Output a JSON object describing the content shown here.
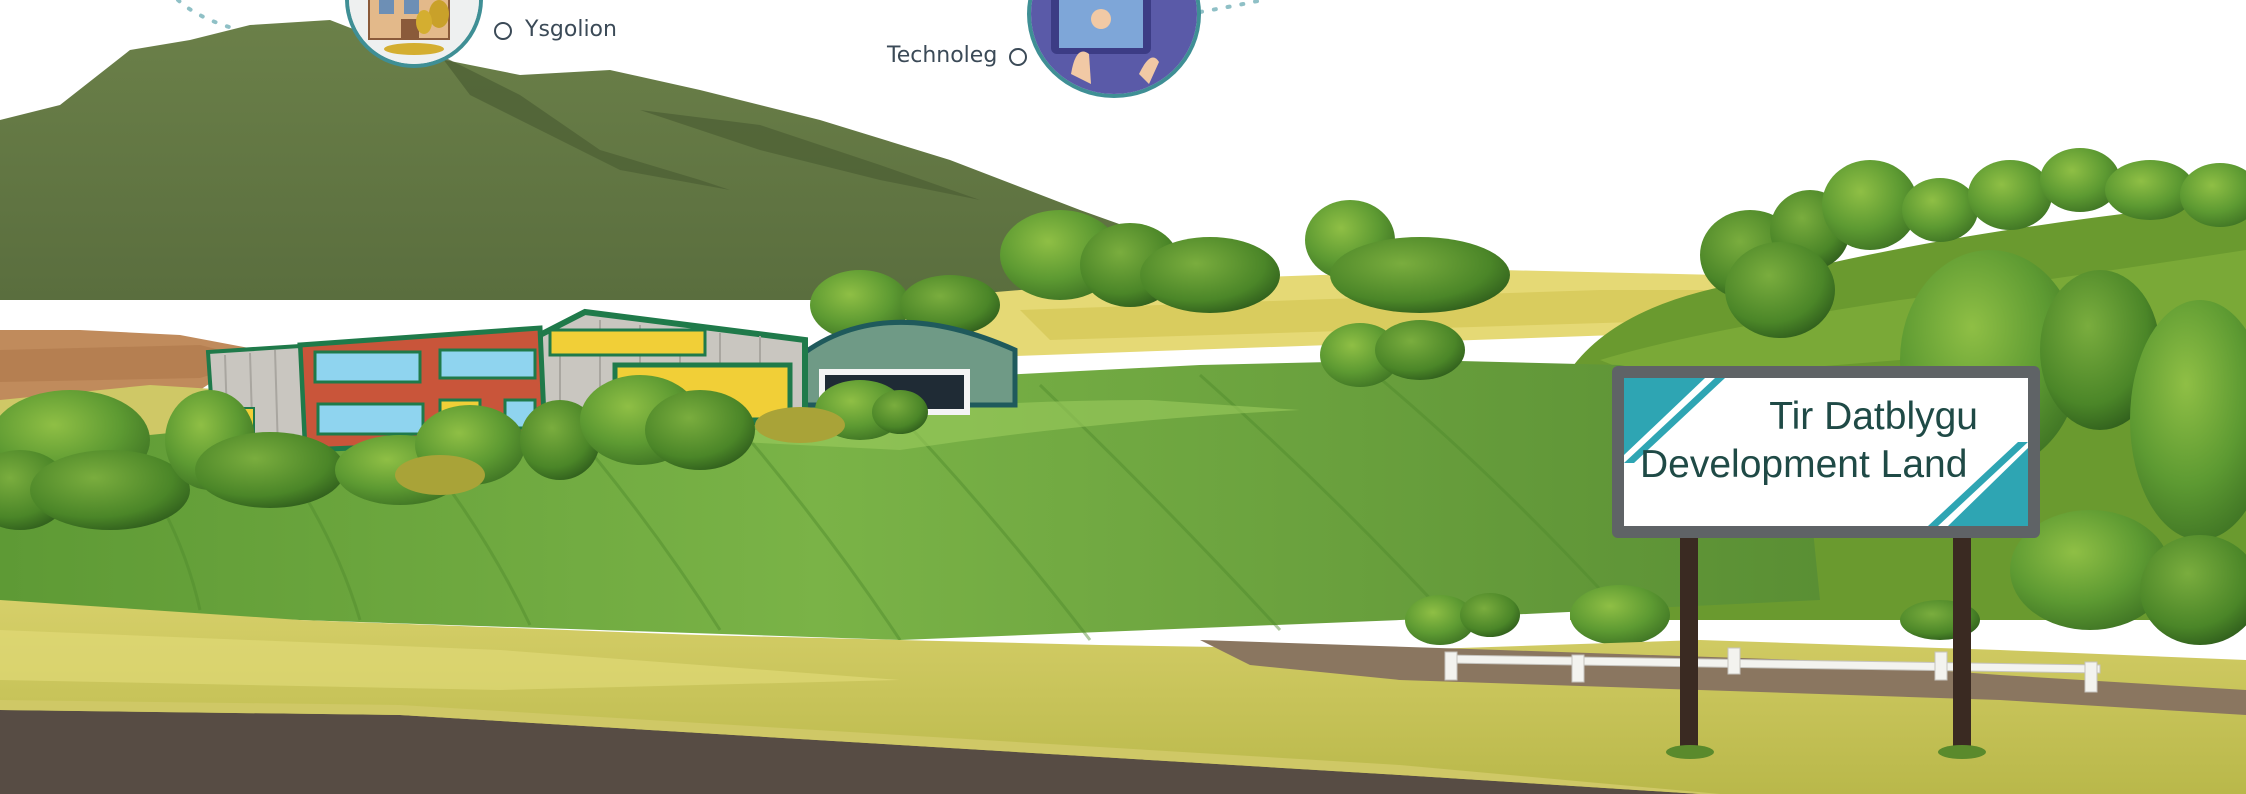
{
  "nav": {
    "schools_label": "Ysgolion",
    "technology_label": "Technoleg"
  },
  "sign": {
    "line1": "Tir Datblygu",
    "line2": "Development Land"
  },
  "icons": {
    "schools": "school-building-icon",
    "technology": "tablet-user-icon"
  },
  "colors": {
    "mountain": "#667a4a",
    "field_green": "#6fa33c",
    "field_yellow": "#c9c35a",
    "road": "#5a4d44",
    "building_red": "#c9553a",
    "building_roof": "#1f7a4a",
    "sign_border": "#5f6366",
    "sign_accent": "#2ea5b3",
    "nav_text": "#3b4a57"
  }
}
